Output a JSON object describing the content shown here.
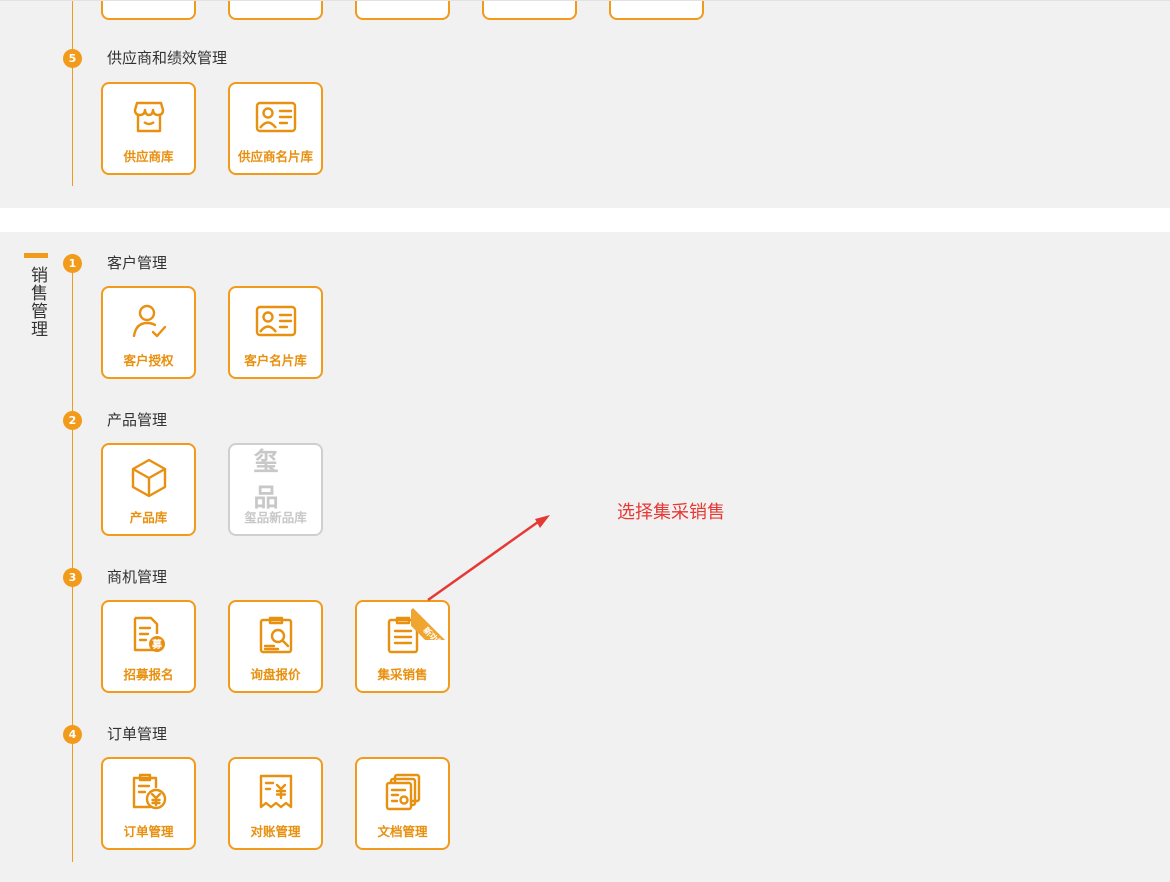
{
  "supplier_section": {
    "step_num": "5",
    "title": "供应商和绩效管理",
    "partial_tiles_count": 5,
    "tiles": [
      {
        "label": "供应商库",
        "icon": "store-icon"
      },
      {
        "label": "供应商名片库",
        "icon": "business-card-icon"
      }
    ]
  },
  "sales_section": {
    "label": "销售管理",
    "groups": [
      {
        "num": "1",
        "title": "客户管理",
        "tiles": [
          {
            "label": "客户授权",
            "icon": "user-check-icon"
          },
          {
            "label": "客户名片库",
            "icon": "business-card-icon"
          }
        ]
      },
      {
        "num": "2",
        "title": "产品管理",
        "tiles": [
          {
            "label": "产品库",
            "icon": "cube-icon"
          },
          {
            "label": "玺品新品库",
            "icon": "xipin-logo-icon",
            "logo_text": "玺品",
            "disabled": true
          }
        ]
      },
      {
        "num": "3",
        "title": "商机管理",
        "tiles": [
          {
            "label": "招募报名",
            "icon": "recruit-doc-icon",
            "badge": "募"
          },
          {
            "label": "询盘报价",
            "icon": "inquiry-search-icon"
          },
          {
            "label": "集采销售",
            "icon": "list-doc-icon",
            "ribbon": "新功能"
          }
        ]
      },
      {
        "num": "4",
        "title": "订单管理",
        "tiles": [
          {
            "label": "订单管理",
            "icon": "order-yen-icon"
          },
          {
            "label": "对账管理",
            "icon": "receipt-yen-icon"
          },
          {
            "label": "文档管理",
            "icon": "documents-icon"
          }
        ]
      }
    ]
  },
  "annotation": {
    "text": "选择集采销售",
    "color": "#e53935"
  },
  "colors": {
    "accent": "#f29a1a",
    "panel_bg": "#f2f1f1",
    "disabled": "#cfcfcf"
  }
}
